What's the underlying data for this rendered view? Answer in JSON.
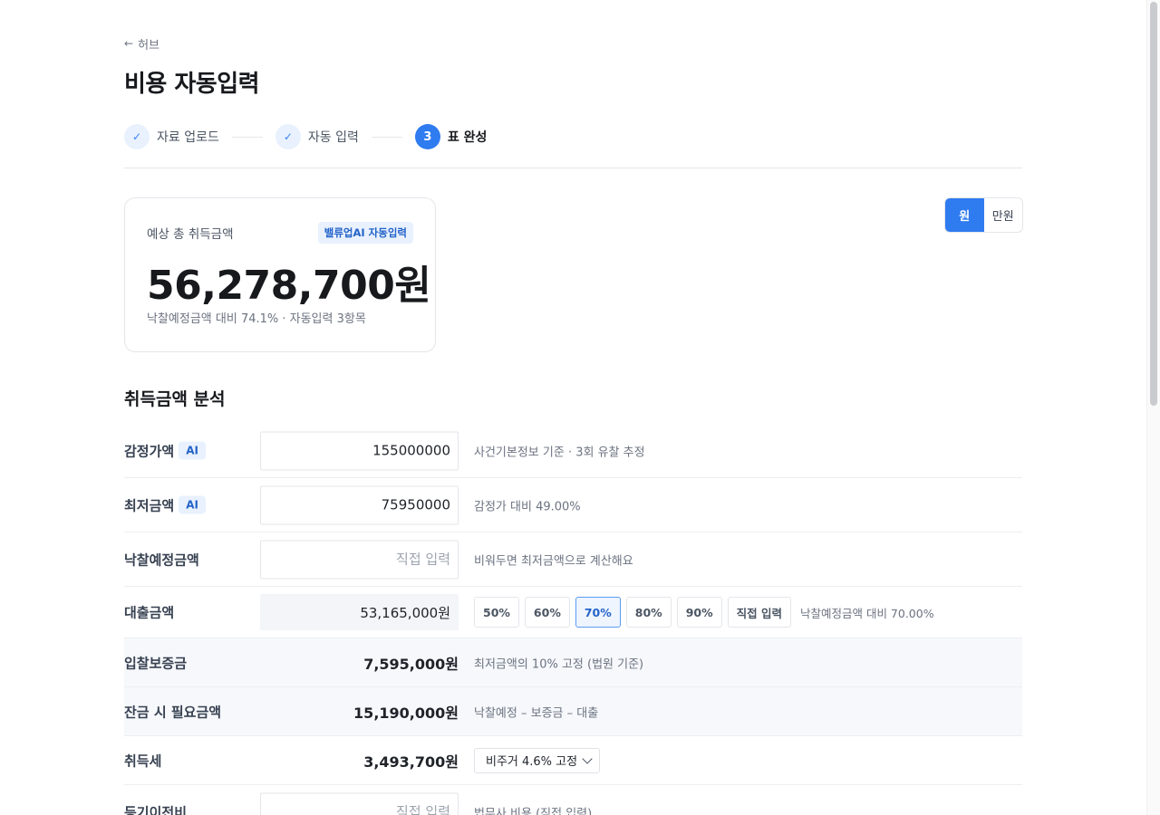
{
  "nav": {
    "back_arrow": "←",
    "back_label": "허브"
  },
  "page_title": "비용 자동입력",
  "steps": [
    {
      "marker": "✓",
      "label": "자료 업로드",
      "state": "done"
    },
    {
      "marker": "✓",
      "label": "자동 입력",
      "state": "done"
    },
    {
      "marker": "3",
      "label": "표 완성",
      "state": "active"
    }
  ],
  "summary": {
    "label": "예상 총 취득금액",
    "badge": "밸류업AI 자동입력",
    "amount": "56,278,700원",
    "sub": "낙찰예정금액 대비 74.1% · 자동입력 3항목"
  },
  "unit_toggle": {
    "options": [
      "원",
      "만원"
    ],
    "selected": "원"
  },
  "section_title": "취득금액 분석",
  "rows": {
    "appraisal": {
      "label": "감정가액",
      "ai": "AI",
      "value": "155000000",
      "note": "사건기본정보 기준 · 3회 유찰 추정"
    },
    "minimum": {
      "label": "최저금액",
      "ai": "AI",
      "value": "75950000",
      "note": "감정가 대비 49.00%"
    },
    "bid": {
      "label": "낙찰예정금액",
      "placeholder": "직접 입력",
      "note": "비워두면 최저금액으로 계산해요"
    },
    "loan": {
      "label": "대출금액",
      "value": "53,165,000원",
      "options": [
        "50%",
        "60%",
        "70%",
        "80%",
        "90%",
        "직접 입력"
      ],
      "selected": "70%",
      "note": "낙찰예정금액 대비 70.00%"
    },
    "deposit": {
      "label": "입찰보증금",
      "value": "7,595,000원",
      "note": "최저금액의 10% 고정 (법원 기준)"
    },
    "balance": {
      "label": "잔금 시 필요금액",
      "value": "15,190,000원",
      "note": "낙찰예정 – 보증금 – 대출"
    },
    "tax": {
      "label": "취득세",
      "value": "3,493,700원",
      "select": "비주거 4.6% 고정"
    },
    "registry": {
      "label": "등기이전비",
      "placeholder": "직접 입력",
      "note": "법무사 비용 (직접 입력)"
    }
  },
  "colors": {
    "accent": "#2f7bf0",
    "ai_badge_bg": "#e8f1fd",
    "ai_badge_text": "#2463c9"
  }
}
